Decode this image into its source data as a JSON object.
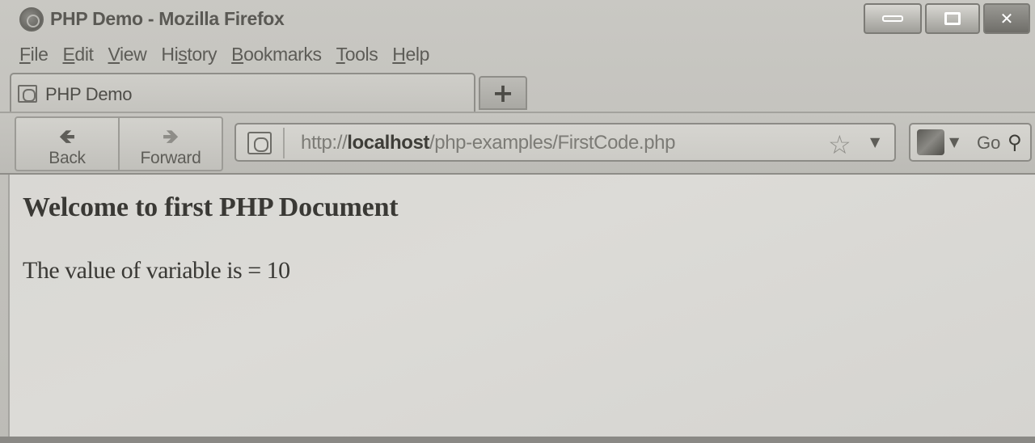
{
  "window": {
    "title": "PHP Demo - Mozilla Firefox"
  },
  "menubar": {
    "items": [
      {
        "label_u": "F",
        "label_rest": "ile"
      },
      {
        "label_u": "E",
        "label_rest": "dit"
      },
      {
        "label_u": "V",
        "label_rest": "iew"
      },
      {
        "label_pre": "Hi",
        "label_u": "s",
        "label_rest": "tory"
      },
      {
        "label_u": "B",
        "label_rest": "ookmarks"
      },
      {
        "label_u": "T",
        "label_rest": "ools"
      },
      {
        "label_u": "H",
        "label_rest": "elp"
      }
    ]
  },
  "tabs": {
    "active": {
      "label": "PHP Demo"
    },
    "new_tab_symbol": "+"
  },
  "navbar": {
    "back_label": "Back",
    "forward_label": "Forward",
    "back_arrow": "🡸",
    "forward_arrow": "🡺",
    "url": {
      "scheme": "http://",
      "host": "localhost",
      "path": "/php-examples/FirstCode.php"
    },
    "search": {
      "go_label": "Go"
    }
  },
  "page": {
    "heading": "Welcome to first PHP Document",
    "body_text": "The value of variable is = 10"
  },
  "icons": {
    "app": "firefox-logo-icon",
    "tab": "page-icon",
    "url": "page-icon",
    "star": "bookmark-star-icon",
    "search_engine": "search-engine-icon",
    "search": "magnifier-icon"
  }
}
